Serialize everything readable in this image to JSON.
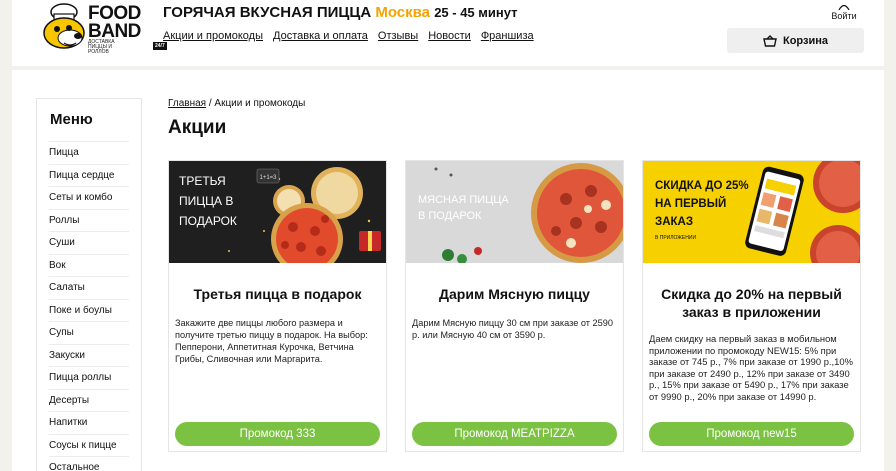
{
  "logo": {
    "line1": "FOOD",
    "line2": "BAND",
    "sub": "ДОСТАВКА ПИЦЦЫ И РОЛЛОВ",
    "badge": "24/7"
  },
  "header": {
    "headline_main": "ГОРЯЧАЯ ВКУСНАЯ ПИЦЦА",
    "headline_city": "Москва",
    "headline_time": "25 - 45 минут",
    "nav": [
      "Акции и промокоды",
      "Доставка и оплата",
      "Отзывы",
      "Новости",
      "Франшиза"
    ],
    "login_label": "Войти",
    "cart_label": "Корзина"
  },
  "sidebar": {
    "title": "Меню",
    "items": [
      "Пицца",
      "Пицца сердце",
      "Сеты и комбо",
      "Роллы",
      "Суши",
      "Вок",
      "Салаты",
      "Поке и боулы",
      "Супы",
      "Закуски",
      "Пицца роллы",
      "Десерты",
      "Напитки",
      "Соусы к пицце",
      "Остальное"
    ]
  },
  "breadcrumb": {
    "home": "Главная",
    "sep": "/",
    "current": "Акции и промокоды"
  },
  "page_title": "Акции",
  "promos": [
    {
      "banner_text": "ТРЕТЬЯ ПИЦЦА В ПОДАРОК",
      "banner_mini": "1+1=3",
      "title": "Третья пицца в подарок",
      "text": "Закажите две пиццы любого размера и получите третью пиццу в подарок. На выбор: Пепперони, Аппетитная Курочка, Ветчина Грибы, Сливочная или Маргарита.",
      "button": "Промокод 333"
    },
    {
      "banner_text": "МЯСНАЯ ПИЦЦА В ПОДАРОК",
      "title": "Дарим Мясную пиццу",
      "text": "Дарим Мясную пиццу 30 см при заказе от 2590 р. или Мясную 40 см от 3590 р.",
      "button": "Промокод MEATPIZZA"
    },
    {
      "banner_text": "СКИДКА ДО 25% НА ПЕРВЫЙ ЗАКАЗ",
      "banner_sub": "В ПРИЛОЖЕНИИ",
      "title": "Скидка до 20% на первый заказ в приложении",
      "text": "Даем скидку на первый заказ в мобильном приложении по промокоду NEW15: 5% при заказе от 745 р., 7% при заказе от 1990 р.,10% при заказе от 2490 р., 12% при заказе от 3490 р., 15% при заказе от 5490 р., 17% при заказе от 9990 р., 20% при заказе от 14990 р.",
      "button": "Промокод new15"
    }
  ],
  "colors": {
    "accent_yellow": "#f5a300",
    "button_green": "#7cc242",
    "banner_yellow": "#f7d000"
  }
}
